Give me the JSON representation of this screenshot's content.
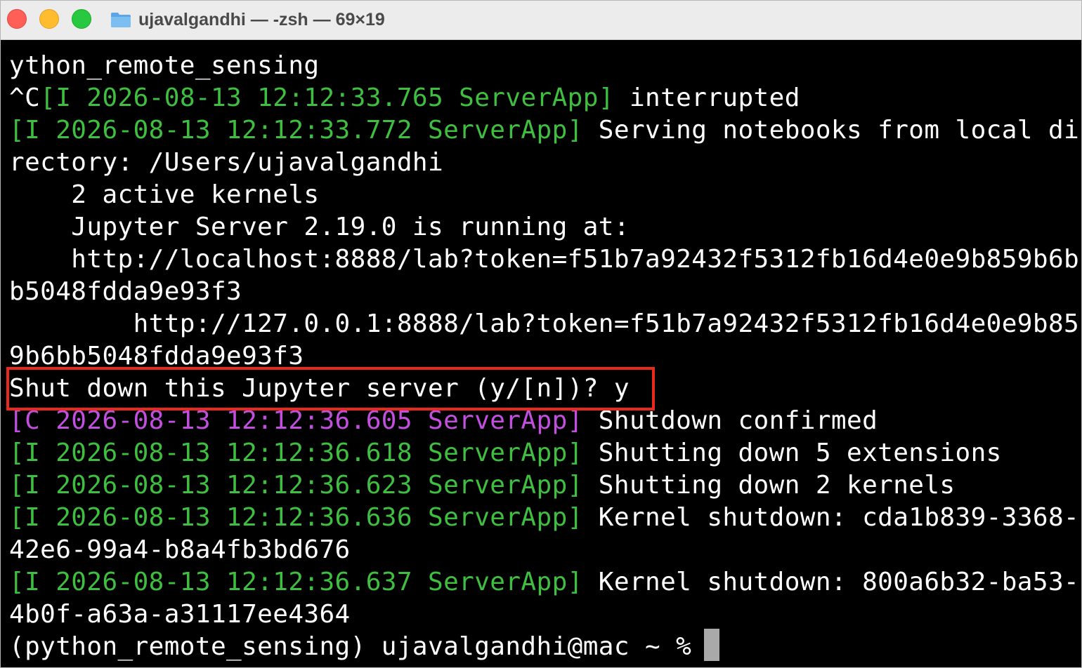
{
  "window": {
    "title": "ujavalgandhi — -zsh — 69×19"
  },
  "colors": {
    "log_info": "#3fbf3f",
    "log_critical": "#c34fe0",
    "highlight_border": "#e8291c",
    "cursor": "#a9a9a9"
  },
  "terminal": {
    "lines": [
      {
        "w1": "ython_remote_sensing"
      },
      {
        "w1": "^C",
        "g": "[I 2026-08-13 12:12:33.765 ServerApp]",
        "w2": " interrupted"
      },
      {
        "g": "[I 2026-08-13 12:12:33.772 ServerApp]",
        "w2": " Serving notebooks from local di"
      },
      {
        "w1": "rectory: /Users/ujavalgandhi"
      },
      {
        "w1": "    2 active kernels"
      },
      {
        "w1": "    Jupyter Server 2.19.0 is running at:"
      },
      {
        "w1": "    http://localhost:8888/lab?token=f51b7a92432f5312fb16d4e0e9b859b6b"
      },
      {
        "w1": "b5048fdda9e93f3"
      },
      {
        "w1": "        http://127.0.0.1:8888/lab?token=f51b7a92432f5312fb16d4e0e9b85"
      },
      {
        "w1": "9b6bb5048fdda9e93f3"
      },
      {
        "w1": "Shut down this Jupyter server (y/[n])? y"
      },
      {
        "m": "[C 2026-08-13 12:12:36.605 ServerApp]",
        "w2": " Shutdown confirmed"
      },
      {
        "g": "[I 2026-08-13 12:12:36.618 ServerApp]",
        "w2": " Shutting down 5 extensions"
      },
      {
        "g": "[I 2026-08-13 12:12:36.623 ServerApp]",
        "w2": " Shutting down 2 kernels"
      },
      {
        "g": "[I 2026-08-13 12:12:36.636 ServerApp]",
        "w2": " Kernel shutdown: cda1b839-3368-"
      },
      {
        "w1": "42e6-99a4-b8a4fb3bd676"
      },
      {
        "g": "[I 2026-08-13 12:12:36.637 ServerApp]",
        "w2": " Kernel shutdown: 800a6b32-ba53-"
      },
      {
        "w1": "4b0f-a63a-a31117ee4364"
      },
      {
        "w1": "(python_remote_sensing) ujavalgandhi@mac ~ % "
      }
    ]
  }
}
